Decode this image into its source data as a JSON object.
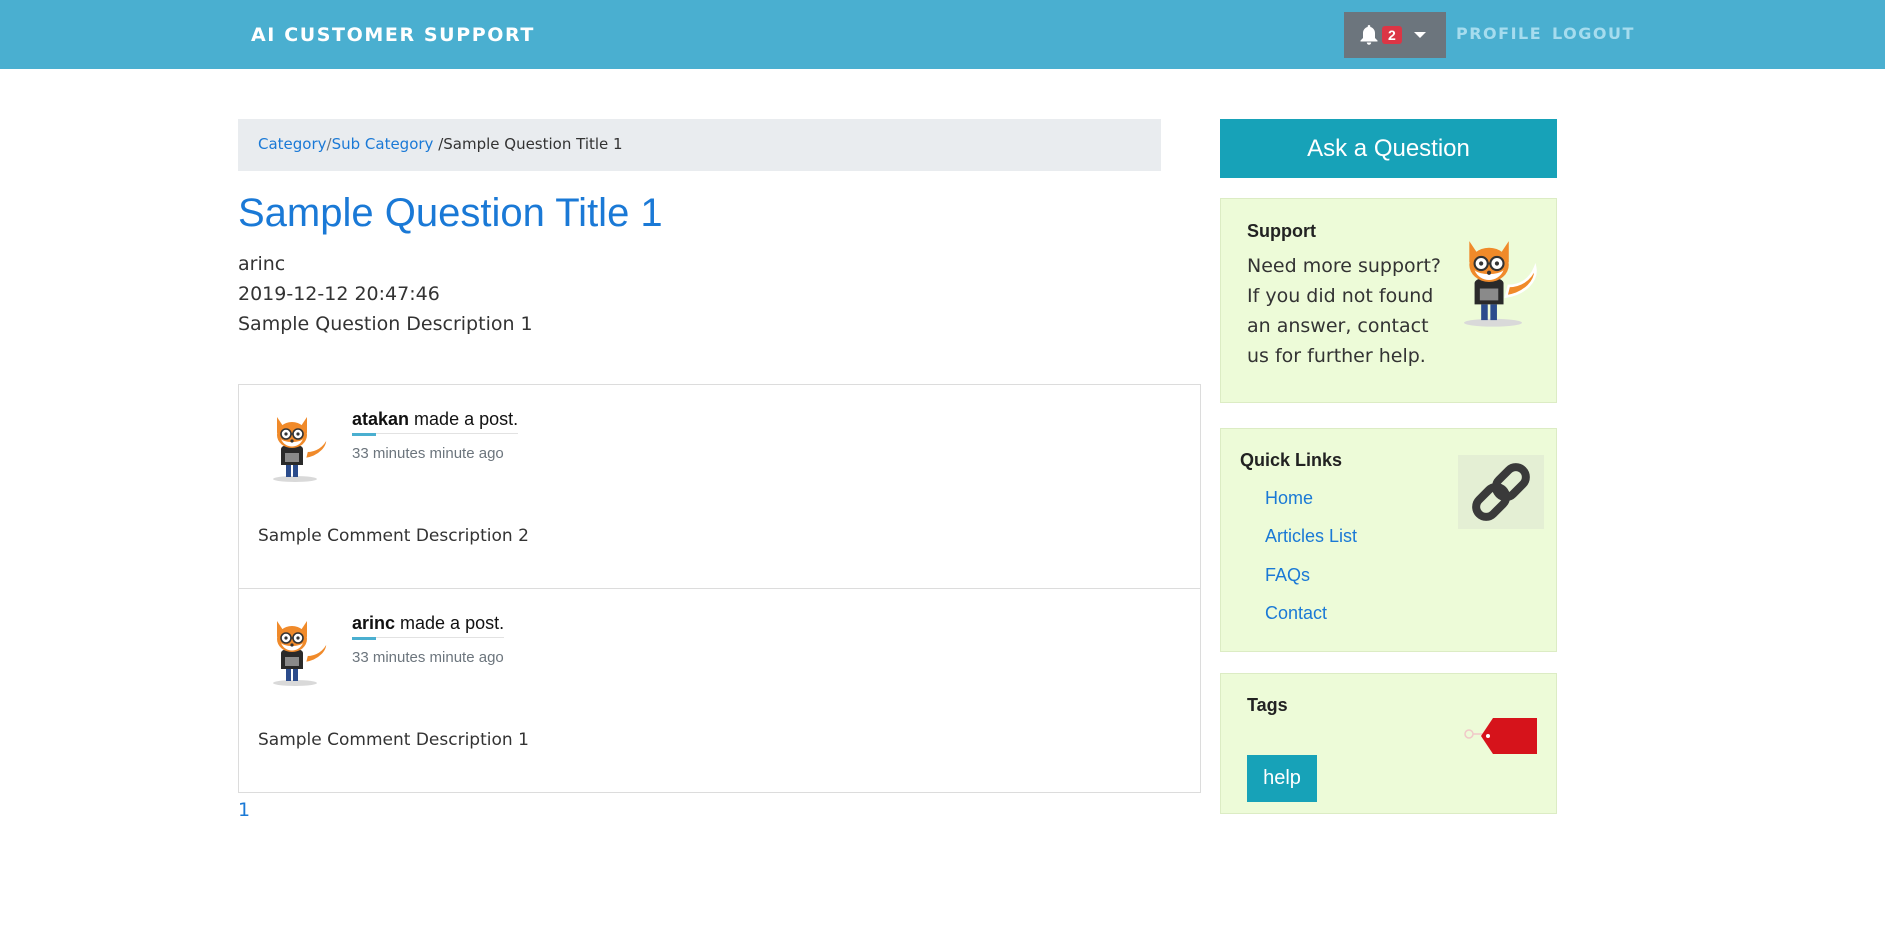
{
  "header": {
    "brand": "AI CUSTOMER SUPPORT",
    "notification_count": "2",
    "nav": {
      "profile": "PROFILE",
      "logout": "LOGOUT"
    }
  },
  "breadcrumb": {
    "category": "Category",
    "separator": "/",
    "sub_category": "Sub Category",
    "current": " /Sample Question Title 1"
  },
  "question": {
    "title": "Sample Question Title 1",
    "author": "arinc",
    "date": "2019-12-12 20:47:46",
    "description": "Sample Question Description 1"
  },
  "comments": [
    {
      "user": "atakan",
      "action": " made a post.",
      "time": "33 minutes minute ago",
      "body": "Sample Comment Description 2"
    },
    {
      "user": "arinc",
      "action": " made a post.",
      "time": "33 minutes minute ago",
      "body": "Sample Comment Description 1"
    }
  ],
  "pagination": {
    "page": "1"
  },
  "sidebar": {
    "ask_button": "Ask a Question",
    "support": {
      "title": "Support",
      "text": "Need more support? If you did not found an answer, contact us for further help."
    },
    "quick_links": {
      "title": "Quick Links",
      "items": [
        "Home",
        "Articles List",
        "FAQs",
        "Contact"
      ]
    },
    "tags": {
      "title": "Tags",
      "items": [
        "help"
      ]
    }
  },
  "colors": {
    "navbar": "#4aafd0",
    "link": "#1a79d6",
    "accent": "#17a2b8",
    "panel_bg": "#edfbd8",
    "badge": "#dc3545"
  }
}
